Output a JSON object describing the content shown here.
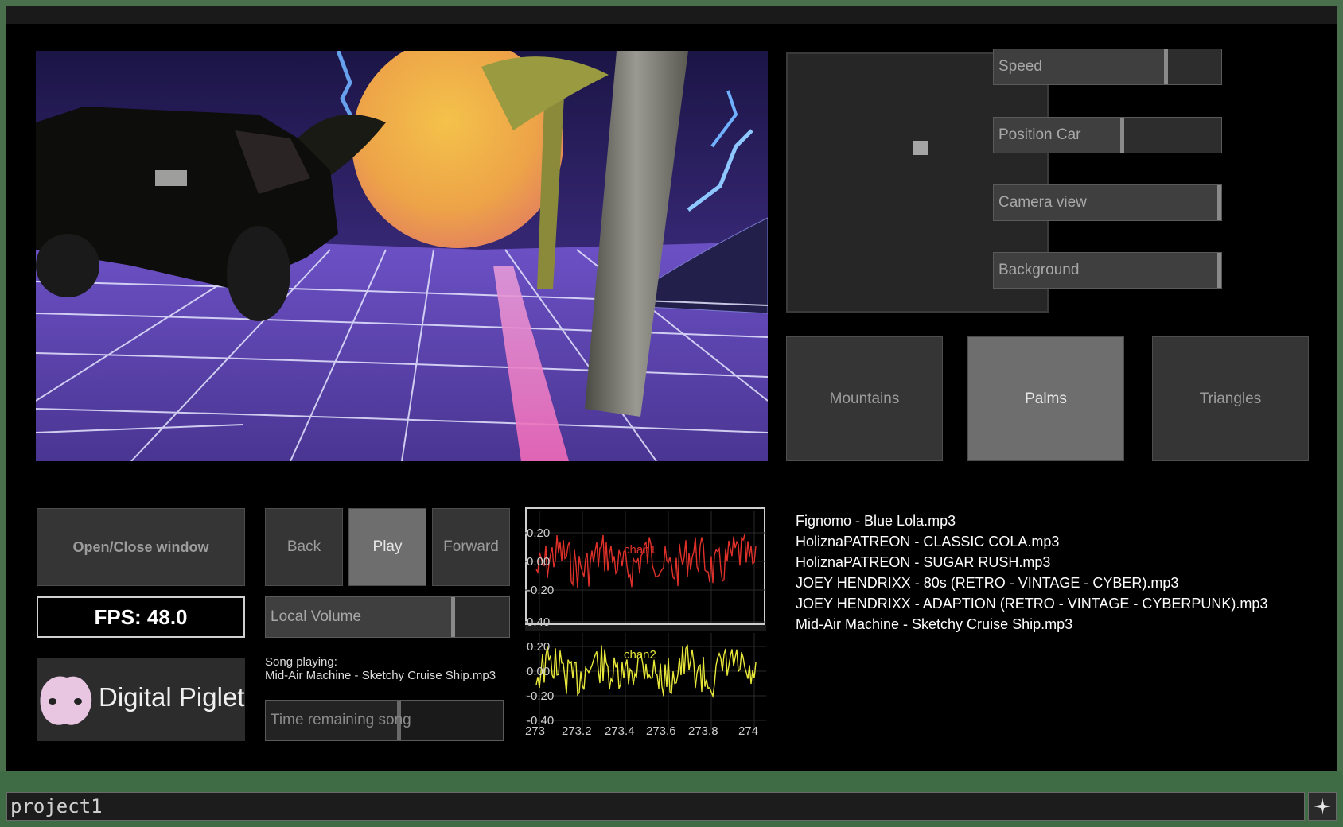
{
  "viewport": {
    "description_icons": [
      "car-icon",
      "moon-icon",
      "palm-tree-icon",
      "lightning-icon",
      "grid-floor-icon"
    ]
  },
  "sliders": {
    "speed": {
      "label": "Speed",
      "value": 0.75
    },
    "position_car": {
      "label": "Position Car",
      "value": 0.55
    },
    "camera_view": {
      "label": "Camera view",
      "value": 1.0
    },
    "background": {
      "label": "Background",
      "value": 1.0
    }
  },
  "scene_buttons": [
    {
      "label": "Mountains",
      "active": false
    },
    {
      "label": "Palms",
      "active": true
    },
    {
      "label": "Triangles",
      "active": false
    }
  ],
  "controls": {
    "open_close": "Open/Close window",
    "back": "Back",
    "play": "Play",
    "forward": "Forward",
    "local_volume": {
      "label": "Local Volume",
      "value": 0.78
    },
    "time_remaining": {
      "label": "Time remaining song",
      "value": 0.55
    }
  },
  "fps": "FPS: 48.0",
  "logo": {
    "text": "Digital Piglet"
  },
  "song": {
    "heading": "Song playing:",
    "name": "Mid-Air Machine - Sketchy Cruise Ship.mp3"
  },
  "playlist": [
    "Fignomo - Blue Lola.mp3",
    "HoliznaPATREON - CLASSIC COLA.mp3",
    "HoliznaPATREON - SUGAR RUSH.mp3",
    "JOEY HENDRIXX - 80s (RETRO - VINTAGE - CYBER).mp3",
    "JOEY HENDRIXX - ADAPTION (RETRO - VINTAGE - CYBERPUNK).mp3",
    "Mid-Air Machine - Sketchy Cruise Ship.mp3"
  ],
  "chart_data": {
    "type": "line",
    "x_ticks": [
      "273",
      "273.2",
      "273.4",
      "273.6",
      "273.8",
      "274"
    ],
    "xlim": [
      273,
      274
    ],
    "channels": [
      {
        "name": "chan1",
        "color": "#e0302a",
        "y_ticks": [
          "0.20",
          "0.00",
          "-0.20"
        ],
        "ylim": [
          -0.28,
          0.28
        ]
      },
      {
        "name": "chan2",
        "color": "#e8e83a",
        "y_ticks": [
          "0.40",
          "0.20",
          "0.00",
          "-0.20",
          "-0.40"
        ],
        "ylim": [
          -0.42,
          0.42
        ]
      }
    ]
  },
  "path": "project1",
  "colors": {
    "accent_red": "#e0302a",
    "accent_yellow": "#e8e83a",
    "panel": "#353535"
  }
}
